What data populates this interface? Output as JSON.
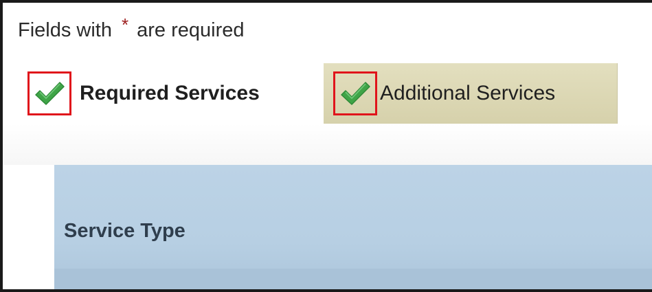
{
  "form": {
    "required_note_prefix": "Fields with",
    "required_star": "*",
    "required_note_suffix": "are required"
  },
  "tabs": [
    {
      "label": "Required Services",
      "completed": true,
      "active": false
    },
    {
      "label": "Additional Services",
      "completed": true,
      "active": true
    }
  ],
  "table": {
    "columns": [
      "Service Type"
    ]
  },
  "colors": {
    "check_green": "#3fa447",
    "highlight_red": "#e0141b",
    "active_tab_bg": "#dcd7b5",
    "header_blue": "#b9d1e5",
    "required_star": "#9c1c1c"
  },
  "icons": {
    "tab_check": "checkmark-icon"
  }
}
